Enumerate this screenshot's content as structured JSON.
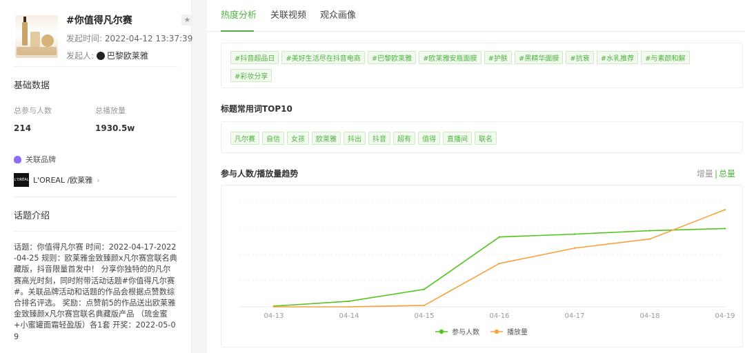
{
  "topic": {
    "title": "#你值得凡尔赛",
    "start_label": "发起时间:",
    "start_time": "2022-04-12 13:37:39",
    "author_label": "发起人:",
    "author": "巴黎欧莱雅"
  },
  "basic": {
    "title": "基础数据",
    "participants_label": "总参与人数",
    "participants": "214",
    "plays_label": "总播放量",
    "plays": "1930.5w",
    "brand_label": "关联品牌",
    "brand_logo_text": "L'ORÉAL",
    "brand_name": "L'OREAL /欧莱雅"
  },
  "intro": {
    "title": "话题介绍",
    "text": "话题：你值得凡尔赛 时间：2022-04-17-2022-04-25 规则：欧莱雅金致臻颜x凡尔赛宫联名典藏版，抖音限量首发中！ 分享你独特的的凡尔赛高光时刻，同时附带活动话题#你值得凡尔赛#。关联品牌活动和话题的作品会根据点赞数综合排名评选。 奖励：点赞前5的作品送出欧莱雅金致臻颜x凡尔赛宫联名典藏版产品 （琉金蜜+小蜜罐面霜轻盈版）各1套 开奖：2022-05-09"
  },
  "tabs": [
    "热度分析",
    "关联视频",
    "观众画像"
  ],
  "related_tags": [
    "#抖音超品日",
    "#美好生活尽在抖音电商",
    "#巴黎欧莱雅",
    "#欧莱雅安瓶面膜",
    "#护肤",
    "#黑精华面膜",
    "#抗衰",
    "#水乳推荐",
    "#与素颜和解",
    "#彩妆分享"
  ],
  "words": {
    "title": "标题常用词TOP10",
    "items": [
      "凡尔赛",
      "自信",
      "女孩",
      "欧莱雅",
      "抖出",
      "抖音",
      "超有",
      "值得",
      "直播间",
      "联名"
    ]
  },
  "trend": {
    "title": "参与人数/播放量趋势",
    "toggle_inc": "增量",
    "toggle_sep": "|",
    "toggle_total": "总量"
  },
  "colors": {
    "accent": "#4db33d",
    "series_participants": "#52c41a",
    "series_plays": "#f7a13b"
  },
  "chart_data": {
    "type": "line",
    "categories": [
      "04-13",
      "04-14",
      "04-15",
      "04-16",
      "04-17",
      "04-18",
      "04-19"
    ],
    "series": [
      {
        "name": "参与人数",
        "values": [
          1,
          8,
          25,
          100,
          104,
          109,
          112
        ]
      },
      {
        "name": "播放量",
        "values": [
          0,
          0,
          2,
          62,
          84,
          97,
          139
        ]
      }
    ],
    "ylim": [
      0,
      150
    ],
    "grid": true,
    "legend": "bottom"
  }
}
